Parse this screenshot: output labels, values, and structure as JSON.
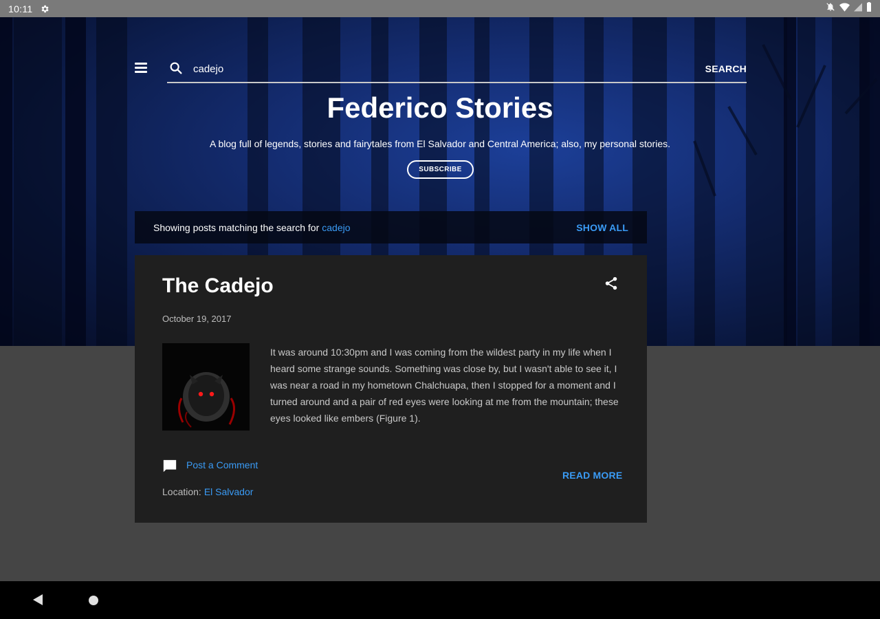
{
  "status_bar": {
    "time": "10:11"
  },
  "header": {
    "search": {
      "value": "cadejo",
      "button_label": "SEARCH"
    },
    "blog_title": "Federico Stories",
    "blog_description": "A blog full of legends, stories and fairytales from El Salvador and Central America; also, my personal stories.",
    "subscribe_label": "SUBSCRIBE"
  },
  "search_result": {
    "prefix": "Showing posts matching the search for",
    "query": "cadejo",
    "show_all_label": "SHOW ALL"
  },
  "post": {
    "title": "The Cadejo",
    "date": "October 19, 2017",
    "excerpt": "It was around 10:30pm and I was coming from the wildest party in my life when I heard some strange sounds. Something was close by, but I wasn't able to see it, I was near a road in my hometown Chalchuapa, then I stopped for a moment and I turned around and a pair of red eyes were looking at me from the mountain; these eyes looked like embers (Figure 1).",
    "comment_label": "Post a Comment",
    "read_more_label": "READ MORE",
    "location_label": "Location:",
    "location_value": "El Salvador"
  },
  "colors": {
    "link": "#3a9bf5",
    "card_bg": "#1f1f1f",
    "page_bg": "#454545"
  }
}
